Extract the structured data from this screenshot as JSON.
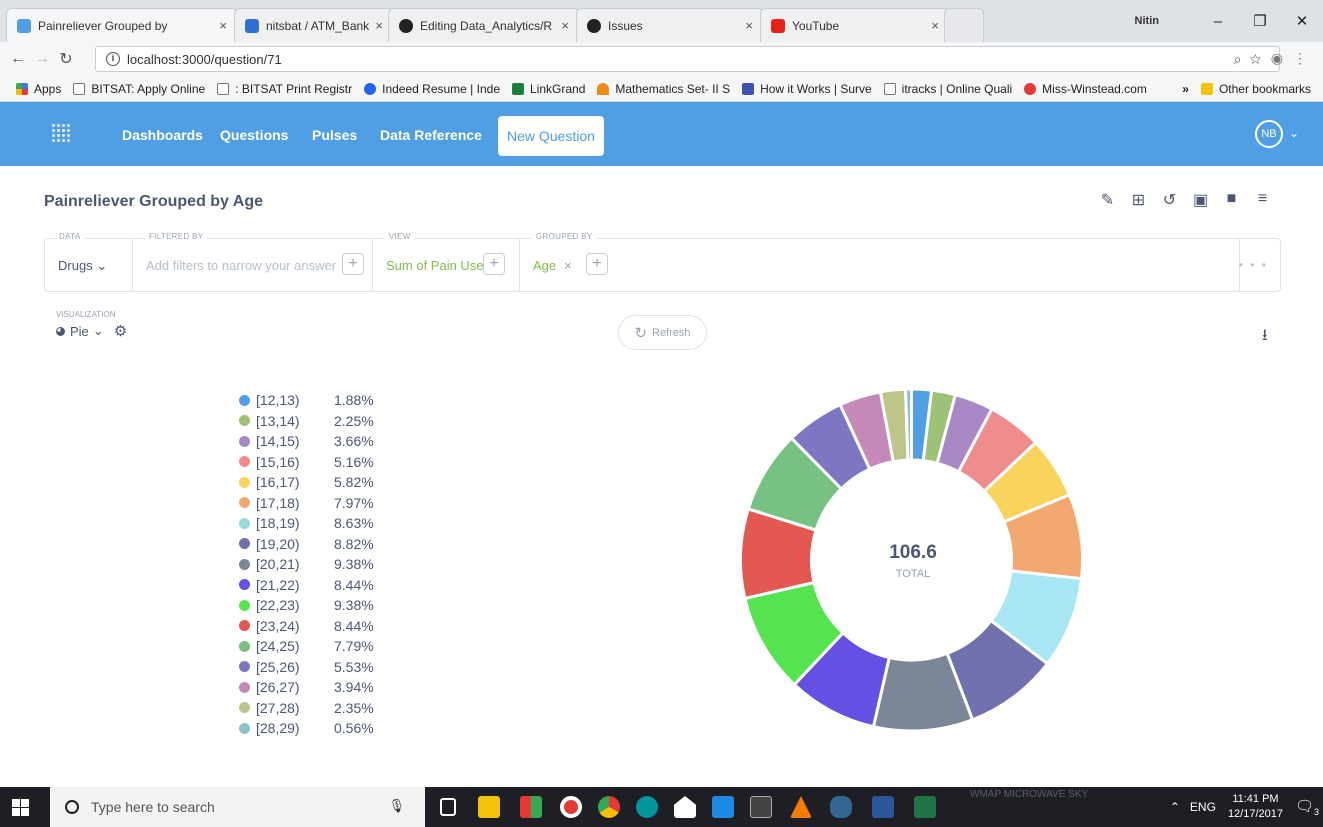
{
  "browser": {
    "tabs": [
      {
        "title": "Painreliever Grouped by",
        "color": "#509ee3",
        "active": true
      },
      {
        "title": "nitsbat / ATM_Banking -",
        "color": "#2f6fd6",
        "active": false
      },
      {
        "title": "Editing Data_Analytics/R",
        "color": "#222222",
        "active": false
      },
      {
        "title": "Issues",
        "color": "#222222",
        "active": false
      },
      {
        "title": "YouTube",
        "color": "#e62117",
        "active": false
      }
    ],
    "tab_close_glyph": "×",
    "user_name": "Nitin",
    "url": "localhost:3000/question/71",
    "bookmarks": [
      {
        "label": "Apps",
        "color": "#3b78e7"
      },
      {
        "label": "BITSAT: Apply Online",
        "color": "#cccccc"
      },
      {
        "label": ": BITSAT Print Registr",
        "color": "#cccccc"
      },
      {
        "label": "Indeed Resume | Inde",
        "color": "#2164f3"
      },
      {
        "label": "LinkGrand",
        "color": "#1a7f3c"
      },
      {
        "label": "Mathematics Set- II S",
        "color": "#f28a1a"
      },
      {
        "label": "How it Works | Surve",
        "color": "#3f51b5"
      },
      {
        "label": "itracks | Online Quali",
        "color": "#cccccc"
      },
      {
        "label": "Miss-Winstead.com",
        "color": "#e53935"
      }
    ],
    "bookmarks_more": "»",
    "other_bookmarks": "Other bookmarks"
  },
  "nav": {
    "links": [
      "Dashboards",
      "Questions",
      "Pulses",
      "Data Reference"
    ],
    "new_question": "New Question",
    "avatar": "NB"
  },
  "question": {
    "title": "Painreliever Grouped by Age",
    "builder": {
      "data_label": "DATA",
      "data_value": "Drugs",
      "filter_label": "FILTERED BY",
      "filter_placeholder": "Add filters to narrow your answer",
      "view_label": "VIEW",
      "view_value": "Sum of Pain Use",
      "group_label": "GROUPED BY",
      "group_value": "Age"
    },
    "visualization_label": "VISUALIZATION",
    "visualization_type": "Pie",
    "refresh": "Refresh"
  },
  "chart_data": {
    "type": "pie",
    "donut": true,
    "total": "106.6",
    "total_label": "TOTAL",
    "categories": [
      "[12,13)",
      "[13,14)",
      "[14,15)",
      "[15,16)",
      "[16,17)",
      "[17,18)",
      "[18,19)",
      "[19,20)",
      "[20,21)",
      "[21,22)",
      "[22,23)",
      "[23,24)",
      "[24,25)",
      "[25,26)",
      "[26,27)",
      "[27,28)",
      "[28,29)"
    ],
    "percent_labels": [
      "1.88%",
      "2.25%",
      "3.66%",
      "5.16%",
      "5.82%",
      "7.97%",
      "8.63%",
      "8.82%",
      "9.38%",
      "8.44%",
      "9.38%",
      "8.44%",
      "7.79%",
      "5.53%",
      "3.94%",
      "2.35%",
      "0.56%"
    ],
    "values": [
      1.88,
      2.25,
      3.66,
      5.16,
      5.82,
      7.97,
      8.63,
      8.82,
      9.38,
      8.44,
      9.38,
      8.44,
      7.79,
      5.53,
      3.94,
      2.35,
      0.56
    ],
    "colors": [
      "#509ee3",
      "#9cc177",
      "#a989c5",
      "#ef8c8c",
      "#f9d45c",
      "#f2a86f",
      "#98d9d9",
      "#7172ad",
      "#7b8797",
      "#6450e3",
      "#55e350",
      "#e35850",
      "#77c183",
      "#7d77c1",
      "#c589b9",
      "#bec589",
      "#89c3c5"
    ],
    "colors_rendered_in_chart": [
      "#509ee3",
      "#9cc177",
      "#a989c5",
      "#ef8c8c",
      "#f9d45c",
      "#f2a86f",
      "#a6e7f3",
      "#7172ad",
      "#7b8797",
      "#6450e3",
      "#55e350",
      "#e35850",
      "#77c183",
      "#7d77c1",
      "#c589b9",
      "#bec589",
      "#89c3c5"
    ]
  },
  "taskbar": {
    "search_placeholder": "Type here to search",
    "watermark": "WMAP MICROWAVE SKY",
    "language": "ENG",
    "time": "11:41 PM",
    "date": "12/17/2017",
    "notification_count": "3"
  }
}
